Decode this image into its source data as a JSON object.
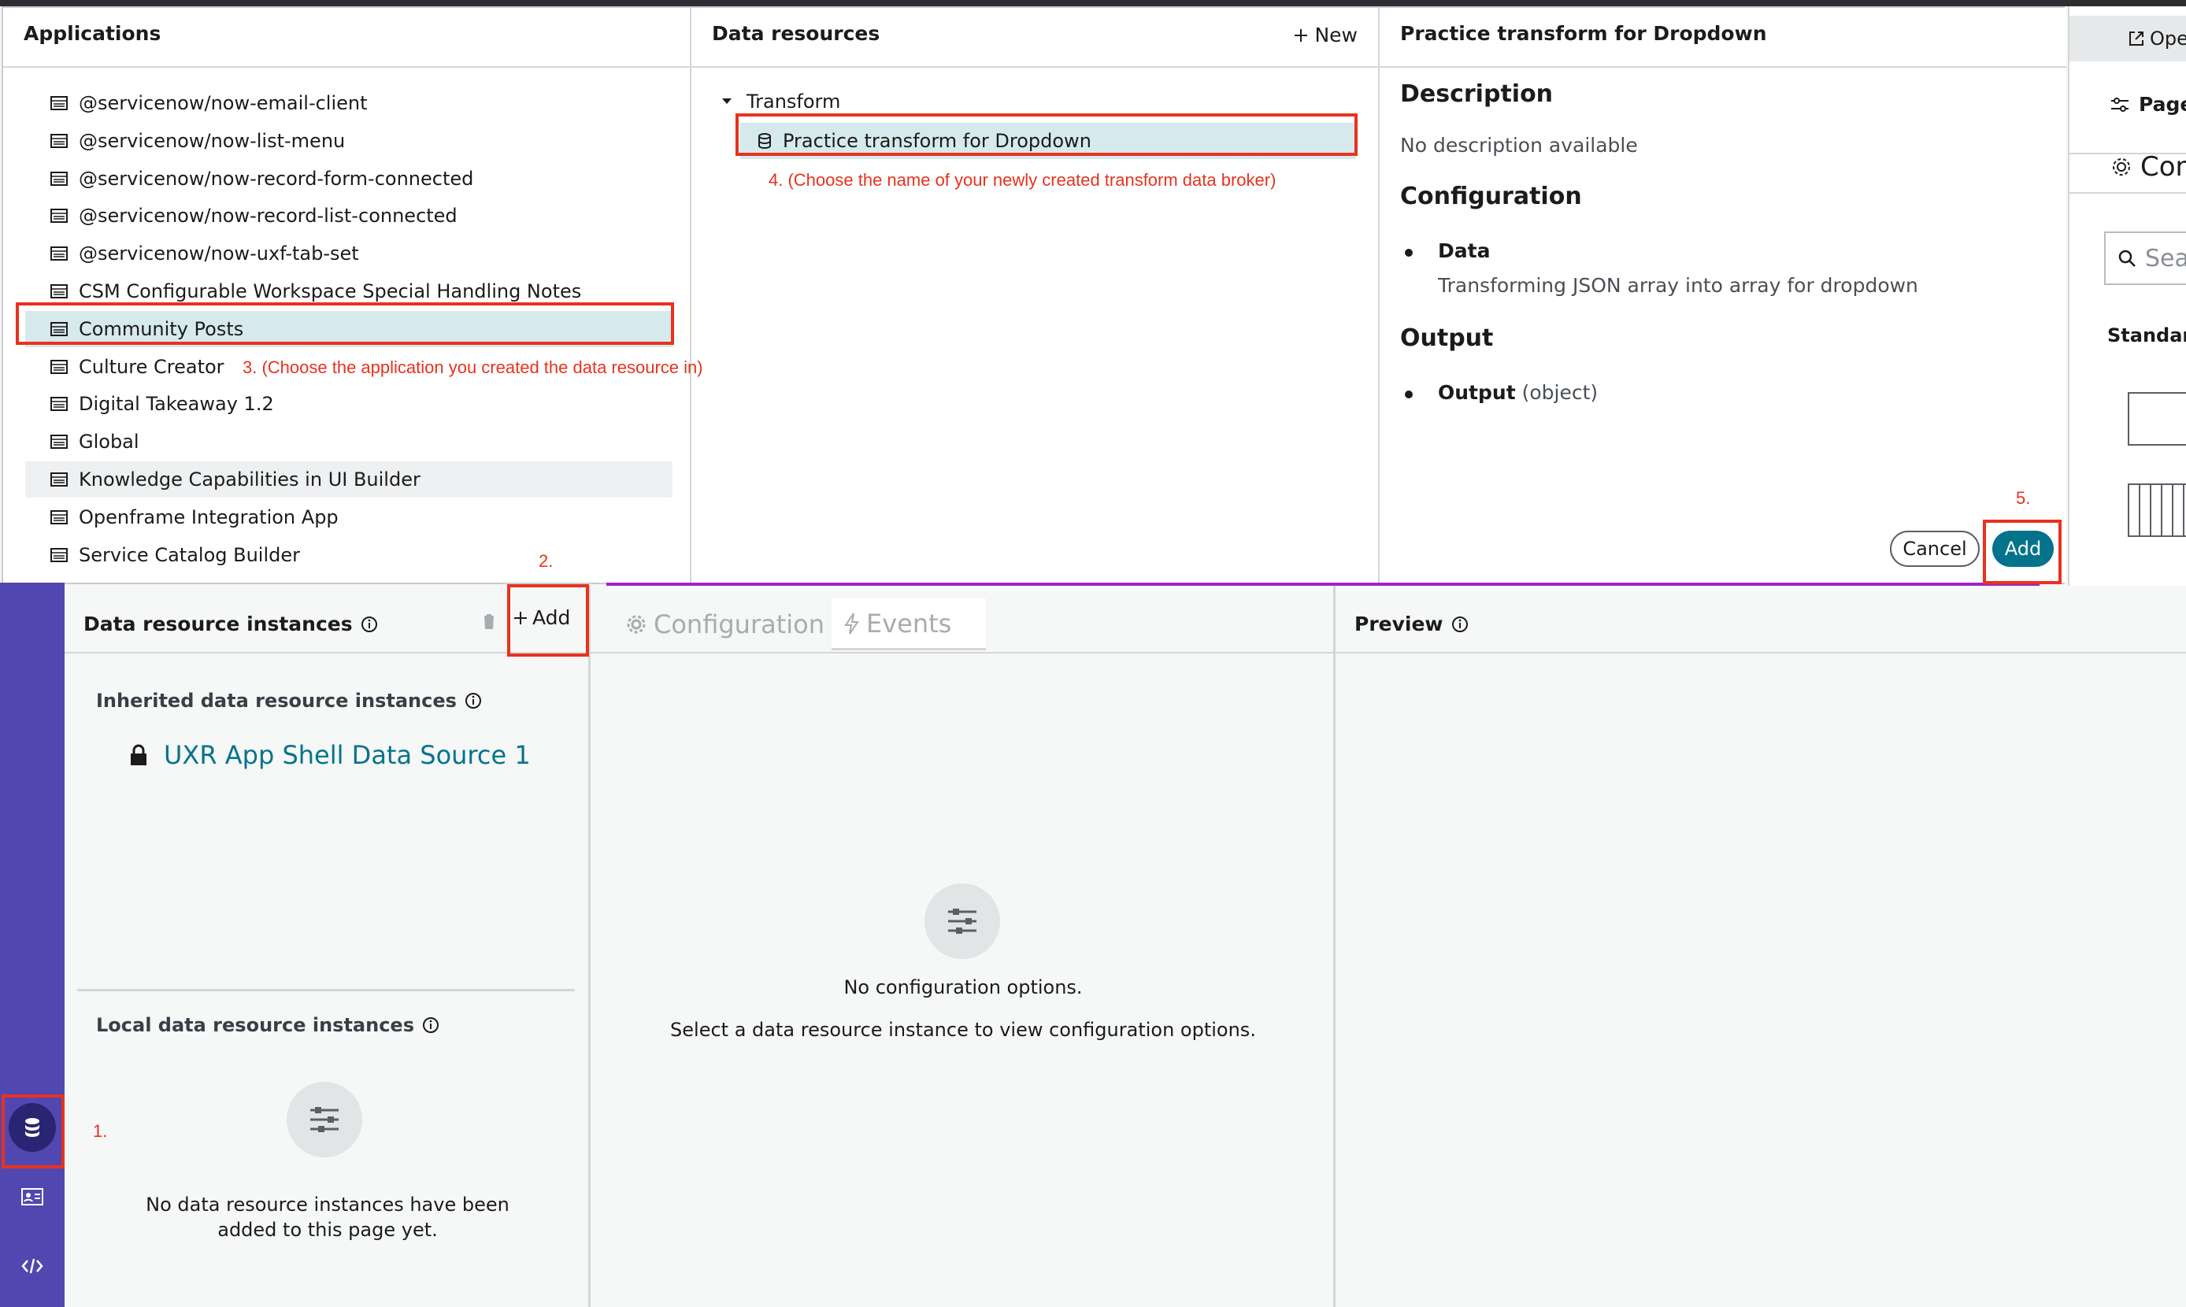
{
  "popup": {
    "applications": {
      "title": "Applications",
      "items": [
        "@servicenow/now-email-client",
        "@servicenow/now-list-menu",
        "@servicenow/now-record-form-connected",
        "@servicenow/now-record-list-connected",
        "@servicenow/now-uxf-tab-set",
        "CSM Configurable Workspace Special Handling Notes",
        "Community Posts",
        "Culture Creator",
        "Digital Takeaway 1.2",
        "Global",
        "Knowledge Capabilities in UI Builder",
        "Openframe Integration App",
        "Service Catalog Builder"
      ],
      "selected": "Community Posts",
      "hovered": "Knowledge Capabilities in UI Builder"
    },
    "data_resources": {
      "title": "Data resources",
      "new_label": "New",
      "group": "Transform",
      "item": "Practice transform for Dropdown"
    },
    "detail": {
      "title": "Practice transform for Dropdown",
      "description_heading": "Description",
      "description": "No description available",
      "configuration_heading": "Configuration",
      "config_item_name": "Data",
      "config_item_desc": "Transforming JSON array into array for dropdown",
      "output_heading": "Output",
      "output_name": "Output",
      "output_type": "(object)",
      "cancel_label": "Cancel",
      "add_label": "Add"
    }
  },
  "right_panel": {
    "open_label": "Ope",
    "page_label": "Page",
    "config_label": "Con",
    "search_placeholder": "Sea",
    "standard_label": "Standar"
  },
  "annotations": {
    "step1": "1.",
    "step2": "2.",
    "step3": "3. (Choose the application you created the data resource in)",
    "step4": "4. (Choose the name of your newly created transform data broker)",
    "step5": "5.",
    "color": "#e8321e"
  },
  "data_resource_panel": {
    "title": "Data resource instances",
    "add_label": "Add",
    "inherited_title": "Inherited data resource instances",
    "inherited_item": "UXR App Shell Data Source 1",
    "local_title": "Local data resource instances",
    "empty_line1": "No data resource instances have been",
    "empty_line2": "added to this page yet."
  },
  "config_panel": {
    "tab_config": "Configuration",
    "tab_events": "Events",
    "empty_title": "No configuration options.",
    "empty_desc": "Select a data resource instance to view configuration options."
  },
  "preview_panel": {
    "title": "Preview"
  },
  "colors": {
    "rail": "#5048b0",
    "accent": "#03738c",
    "selected_row": "#d6e9ec"
  }
}
